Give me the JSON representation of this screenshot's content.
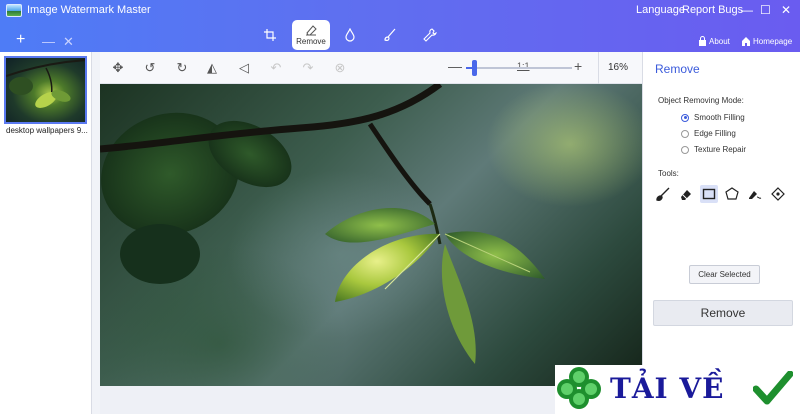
{
  "app": {
    "title": "Image Watermark Master"
  },
  "titlebar": {
    "language": "Language",
    "report_bugs": "Report Bugs",
    "about": "About",
    "homepage": "Homepage",
    "add_icon": "plus-icon",
    "close_icon": "x-icon"
  },
  "tool_tabs": [
    {
      "name": "crop",
      "icon": "crop-icon"
    },
    {
      "name": "remove",
      "label": "Remove",
      "icon": "eraser-icon",
      "active": true
    },
    {
      "name": "watermark",
      "icon": "drop-icon"
    },
    {
      "name": "brush",
      "icon": "brush-icon"
    },
    {
      "name": "repair",
      "icon": "wrench-icon"
    }
  ],
  "thumbnails": [
    {
      "label": "desktop wallpapers 9..."
    }
  ],
  "toolbar": {
    "ratio": "1:1",
    "zoom_percent": "16%",
    "zoom_level": 0.08
  },
  "right_panel": {
    "title": "Remove",
    "mode_label": "Object Removing Mode:",
    "modes": [
      {
        "label": "Smooth Filling",
        "selected": true
      },
      {
        "label": "Edge Filling",
        "selected": false
      },
      {
        "label": "Texture Repair",
        "selected": false
      }
    ],
    "tools_label": "Tools:",
    "clear_selected": "Clear Selected",
    "remove_button": "Remove"
  },
  "watermark": {
    "text": "TẢI VỀ"
  },
  "colors": {
    "accent": "#4a68ea",
    "titlebar_start": "#4e7cf6",
    "titlebar_end": "#6a5cf0"
  }
}
